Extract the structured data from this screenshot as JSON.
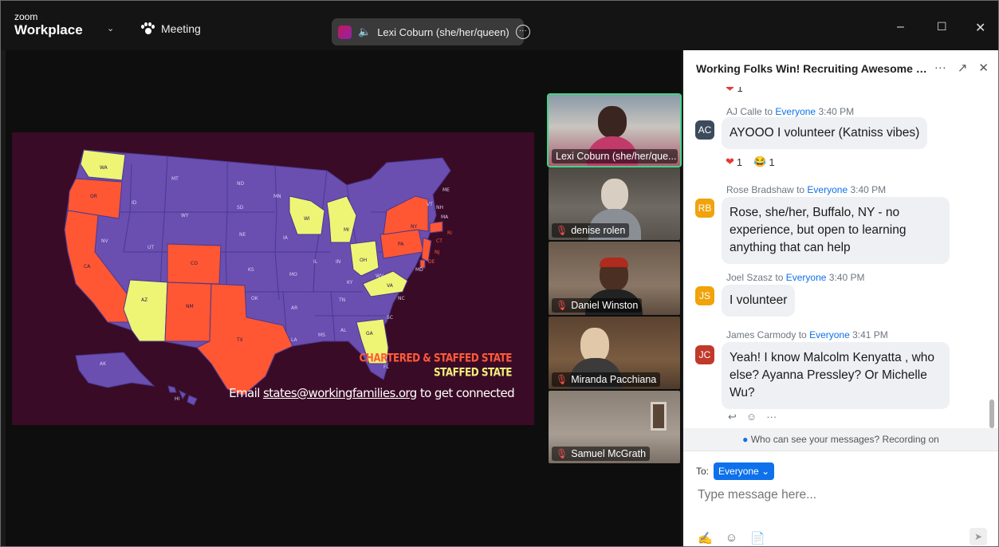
{
  "titlebar": {
    "brand_small": "zoom",
    "brand_big": "Workplace",
    "meeting_label": "Meeting",
    "active_speaker": "Lexi Coburn (she/her/queen)",
    "minimize": "–",
    "maximize": "☐",
    "close": "✕"
  },
  "slide": {
    "legend_chartered": "CHARTERED & STAFFED STATE",
    "legend_staffed": "STAFFED STATE",
    "email_prefix": "Email ",
    "email_link": "states@workingfamilies.org",
    "email_suffix": " to get connected",
    "colors": {
      "background": "#3a0b26",
      "purple": "#6a4fb1",
      "chartered": "#ff5733",
      "staffed": "#eef575"
    },
    "state_labels": [
      "WA",
      "OR",
      "ID",
      "MT",
      "ND",
      "SD",
      "WY",
      "NE",
      "NV",
      "UT",
      "CO",
      "CA",
      "AZ",
      "NM",
      "KS",
      "OK",
      "TX",
      "MN",
      "IA",
      "MO",
      "AR",
      "LA",
      "WI",
      "IL",
      "MI",
      "IN",
      "OH",
      "KY",
      "TN",
      "MS",
      "AL",
      "GA",
      "FL",
      "SC",
      "NC",
      "VA",
      "WV",
      "PA",
      "NY",
      "ME",
      "VT",
      "NH",
      "MA",
      "RI",
      "CT",
      "NJ",
      "DE",
      "MD",
      "AK",
      "HI"
    ]
  },
  "gallery": [
    {
      "name": "Lexi Coburn (she/her/que...",
      "muted": false
    },
    {
      "name": "denise rolen",
      "muted": true
    },
    {
      "name": "Daniel Winston",
      "muted": true
    },
    {
      "name": "Miranda Pacchiana",
      "muted": true
    },
    {
      "name": "Samuel McGrath",
      "muted": true
    }
  ],
  "chat": {
    "title": "Working Folks Win! Recruiting Awesome C...",
    "header_icons": [
      "more-icon",
      "popout-icon",
      "close-icon"
    ],
    "cut_reaction_count": "1",
    "messages": [
      {
        "sender": "AJ Calle",
        "to_word": "to",
        "recipient": "Everyone",
        "time": "3:40 PM",
        "initials": "AC",
        "avatar_color": "#3b4a5c",
        "text": "AYOOO I volunteer (Katniss vibes)",
        "reactions": [
          {
            "emoji": "❤",
            "count": "1"
          },
          {
            "emoji": "😂",
            "count": "1"
          }
        ]
      },
      {
        "sender": "Rose Bradshaw",
        "to_word": "to",
        "recipient": "Everyone",
        "time": "3:40 PM",
        "initials": "RB",
        "avatar_color": "#f0a30a",
        "text": "Rose, she/her, Buffalo, NY - no experience, but open to learning anything that can help"
      },
      {
        "sender": "Joel Szasz",
        "to_word": "to",
        "recipient": "Everyone",
        "time": "3:40 PM",
        "initials": "JS",
        "avatar_color": "#f0a30a",
        "text": "I volunteer"
      },
      {
        "sender": "James Carmody",
        "to_word": "to",
        "recipient": "Everyone",
        "time": "3:41 PM",
        "initials": "JC",
        "avatar_color": "#c0392b",
        "text": "Yeah! I know Malcolm Kenyatta , who else? Ayanna Pressley? Or Michelle Wu?"
      }
    ],
    "privacy_notice": "Who can see your messages? Recording on",
    "to_label": "To:",
    "to_value": "Everyone",
    "input_placeholder": "Type message here..."
  }
}
